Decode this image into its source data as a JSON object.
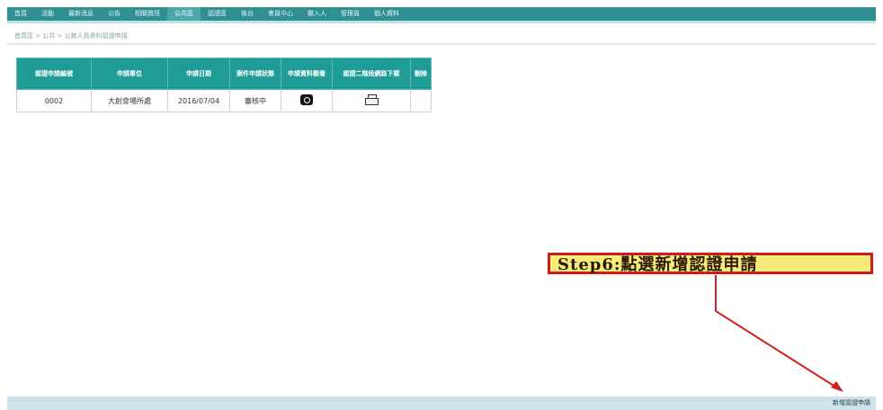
{
  "nav": {
    "items": [
      "首頁",
      "活動",
      "最新消息",
      "公告",
      "相關資訊",
      "公共區",
      "認證區",
      "後台",
      "會員中心",
      "聯入人",
      "管理員",
      "個人資料"
    ],
    "active_index": 5
  },
  "breadcrumb": "首頁區 > 公共 > 公務人員資料認證申請",
  "table": {
    "headers": [
      "認證申請編號",
      "申請單位",
      "申請日期",
      "案件申請狀態",
      "申請資料觀看",
      "認證二階段網路下載",
      "刪除"
    ],
    "rows": [
      {
        "id": "0002",
        "unit": "大創會場所處",
        "date": "2016/07/04",
        "status": "審核中",
        "view_icon": "view-icon",
        "download_icon": "printer-icon",
        "delete": ""
      }
    ]
  },
  "footer": {
    "add_button_label": "新增認證申請"
  },
  "annotation": {
    "text": "Step6:點選新增認證申請",
    "border_color": "#d01b1b",
    "fill_color": "#f7eb7a",
    "arrow_color": "#d21e1e"
  },
  "colors": {
    "nav_bg": "#2f8f92",
    "header_bg": "#1f9c95"
  }
}
